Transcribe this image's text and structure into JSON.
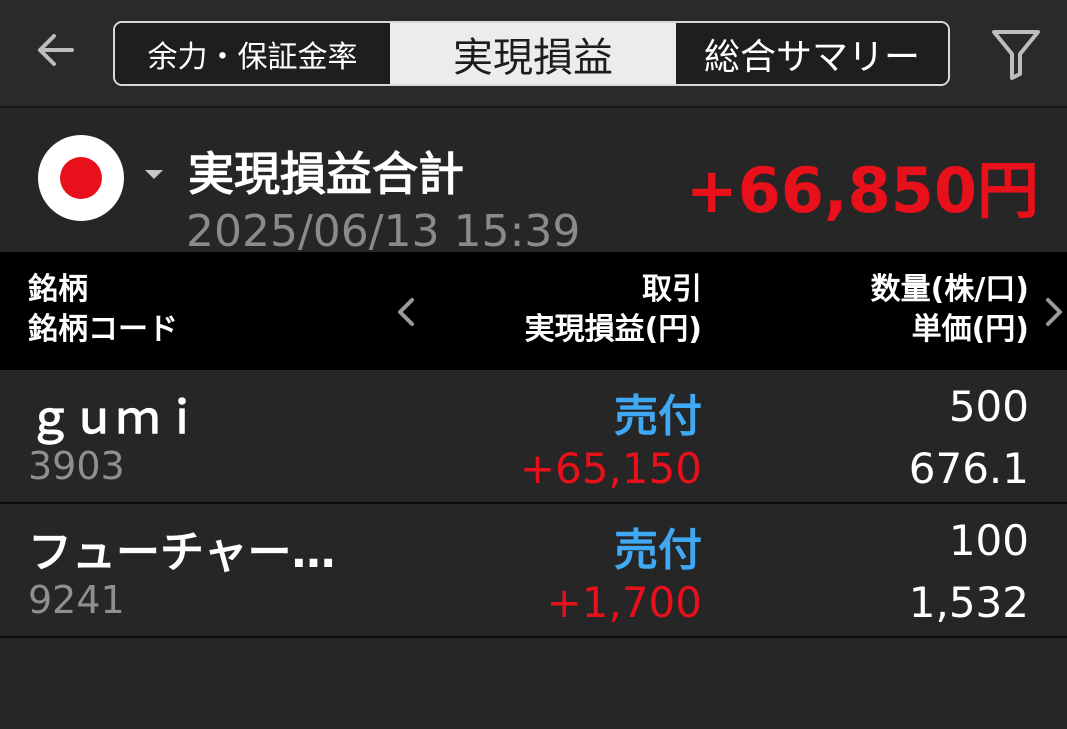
{
  "header": {
    "tabs": [
      {
        "label": "余力・保証金率",
        "selected": false
      },
      {
        "label": "実現損益",
        "selected": true
      },
      {
        "label": "総合サマリー",
        "selected": false
      }
    ],
    "back_icon": "arrow-left-icon",
    "filter_icon": "funnel-filter-icon"
  },
  "summary": {
    "market_flag_icon": "japan-flag-icon",
    "title": "実現損益合計",
    "datetime": "2025/06/13 15:39",
    "total": "+66,850円"
  },
  "table": {
    "columns": {
      "col1": [
        "銘柄",
        "銘柄コード"
      ],
      "col2": [
        "取引",
        "実現損益(円)"
      ],
      "col3": [
        "数量(株/口)",
        "単価(円)"
      ]
    },
    "rows": [
      {
        "name": "ｇｕｍｉ",
        "code": "3903",
        "trade": "売付",
        "profit": "+65,150",
        "quantity": "500",
        "price": "676.1"
      },
      {
        "name": "フューチャー…",
        "code": "9241",
        "trade": "売付",
        "profit": "+1,700",
        "quantity": "100",
        "price": "1,532"
      }
    ]
  },
  "colors": {
    "background": "#262626",
    "header_background": "#000000",
    "profit_red": "#e8101a",
    "trade_blue": "#3fa9f5",
    "muted_gray": "#8f8f8f"
  }
}
